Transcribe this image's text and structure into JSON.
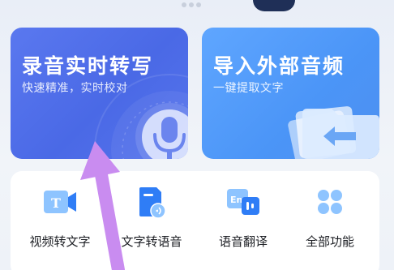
{
  "cards": {
    "record": {
      "title": "录音实时转写",
      "subtitle": "快速精准，实时校对"
    },
    "import": {
      "title": "导入外部音频",
      "subtitle": "一键提取文字"
    }
  },
  "tools": [
    {
      "label": "视频转文字",
      "icon": "video-to-text-icon"
    },
    {
      "label": "文字转语音",
      "icon": "text-to-speech-icon"
    },
    {
      "label": "语音翻译",
      "icon": "voice-translate-icon"
    },
    {
      "label": "全部功能",
      "icon": "all-features-icon"
    }
  ],
  "colors": {
    "record_card": "#4a69e6",
    "import_card": "#4b95f7",
    "icon_blue": "#2f7df6",
    "annotation_arrow": "#c98cf0"
  }
}
